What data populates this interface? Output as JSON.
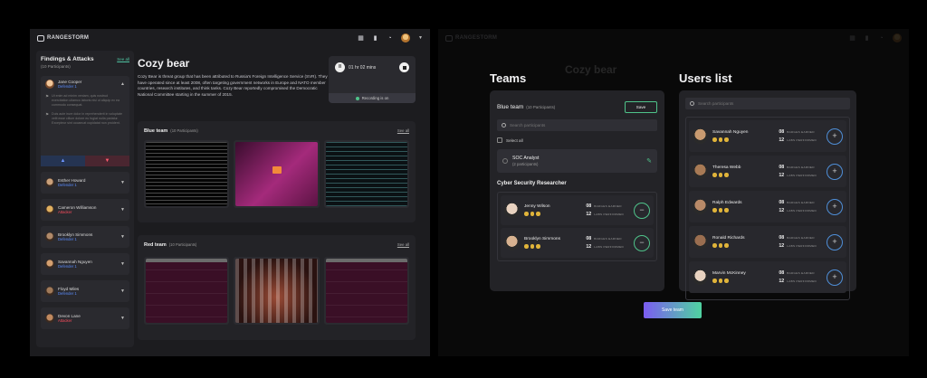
{
  "app": {
    "logo_text": "RANGESTORM"
  },
  "sidebar": {
    "title": "Findings & Attacks",
    "see_all": "See all",
    "participants": "(10 Participants)",
    "expanded": {
      "name": "Jane Cooper",
      "role": "Defender 1",
      "comments": [
        "Ut enim ad minim veniam, quis nostrud exercitation ullamco laboris nisi ut aliquip ex ea commodo consequat.",
        "Duis aute irure dolor in reprehenderit in voluptate velit esse cillum dolore eu fugiat nulla pariatur. Excepteur sint occaecat cupidatat non proident."
      ]
    },
    "people": [
      {
        "name": "Esther Howard",
        "role": "Defender 1",
        "type": "def",
        "color": "#c9a07a"
      },
      {
        "name": "Cameron Williamson",
        "role": "Attacker",
        "type": "att",
        "color": "#e0b060"
      },
      {
        "name": "Brooklyn Simmons",
        "role": "Defender 1",
        "type": "def",
        "color": "#b08a6a"
      },
      {
        "name": "Savannah Nguyen",
        "role": "Defender 1",
        "type": "def",
        "color": "#d4a070"
      },
      {
        "name": "Floyd Miles",
        "role": "Defender 1",
        "type": "def",
        "color": "#a07a5a"
      },
      {
        "name": "Devon Lane",
        "role": "Attacker",
        "type": "att",
        "color": "#c08a60"
      }
    ]
  },
  "main": {
    "title": "Cozy bear",
    "description": "Cozy Bear is threat group that has been attributed to Russia's Foreign Intelligence Service (SVR). They have operated since at least 2008, often targeting government networks in Europe and NATO member countries, research institutes, and think tanks. Cozy Bear reportedly compromised the Democratic National Committee starting in the summer of 2015.",
    "timer": "01 hr 02 mins",
    "recording": "Recording is on",
    "blue_team": {
      "title": "Blue team",
      "count": "(10 Participants)",
      "see_all": "See all"
    },
    "red_team": {
      "title": "Red team",
      "count": "(10 Participants)",
      "see_all": "See all"
    }
  },
  "teams_panel": {
    "heading": "Teams",
    "blue_team_title": "Blue team",
    "blue_team_count": "(10 Participants)",
    "save_label": "Save",
    "search_placeholder": "Search participants",
    "select_all": "Select all",
    "role_title": "SOC Analyst",
    "role_sub": "(2 participants)",
    "section_title": "Cyber Security Researcher",
    "members": [
      {
        "name": "Jenny Wilson",
        "badges": "08",
        "badges_label": "BADGES EARNED",
        "labs": "12",
        "labs_label": "LABS PERFORMED"
      },
      {
        "name": "Brooklyn Simmons",
        "badges": "08",
        "badges_label": "BADGES EARNED",
        "labs": "12",
        "labs_label": "LABS PERFORMED"
      }
    ]
  },
  "users_panel": {
    "heading": "Users list",
    "search_placeholder": "Search participants",
    "users": [
      {
        "name": "Savannah Nguyen",
        "badges": "08",
        "badges_label": "BADGES EARNED",
        "labs": "12",
        "labs_label": "LABS PERFORMED"
      },
      {
        "name": "Theresa Webb",
        "badges": "08",
        "badges_label": "BADGES EARNED",
        "labs": "12",
        "labs_label": "LABS PERFORMED"
      },
      {
        "name": "Ralph Edwards",
        "badges": "08",
        "badges_label": "BADGES EARNED",
        "labs": "12",
        "labs_label": "LABS PERFORMED"
      },
      {
        "name": "Ronald Richards",
        "badges": "08",
        "badges_label": "BADGES EARNED",
        "labs": "12",
        "labs_label": "LABS PERFORMED"
      },
      {
        "name": "Marvin McKinney",
        "badges": "08",
        "badges_label": "BADGES EARNED",
        "labs": "12",
        "labs_label": "LABS PERFORMED"
      }
    ]
  },
  "save_team_label": "Save team",
  "colors": {
    "accent_green": "#4fc38a",
    "accent_blue": "#4f8fd8",
    "defender": "#5b8dff",
    "attacker": "#ff4d5e"
  }
}
